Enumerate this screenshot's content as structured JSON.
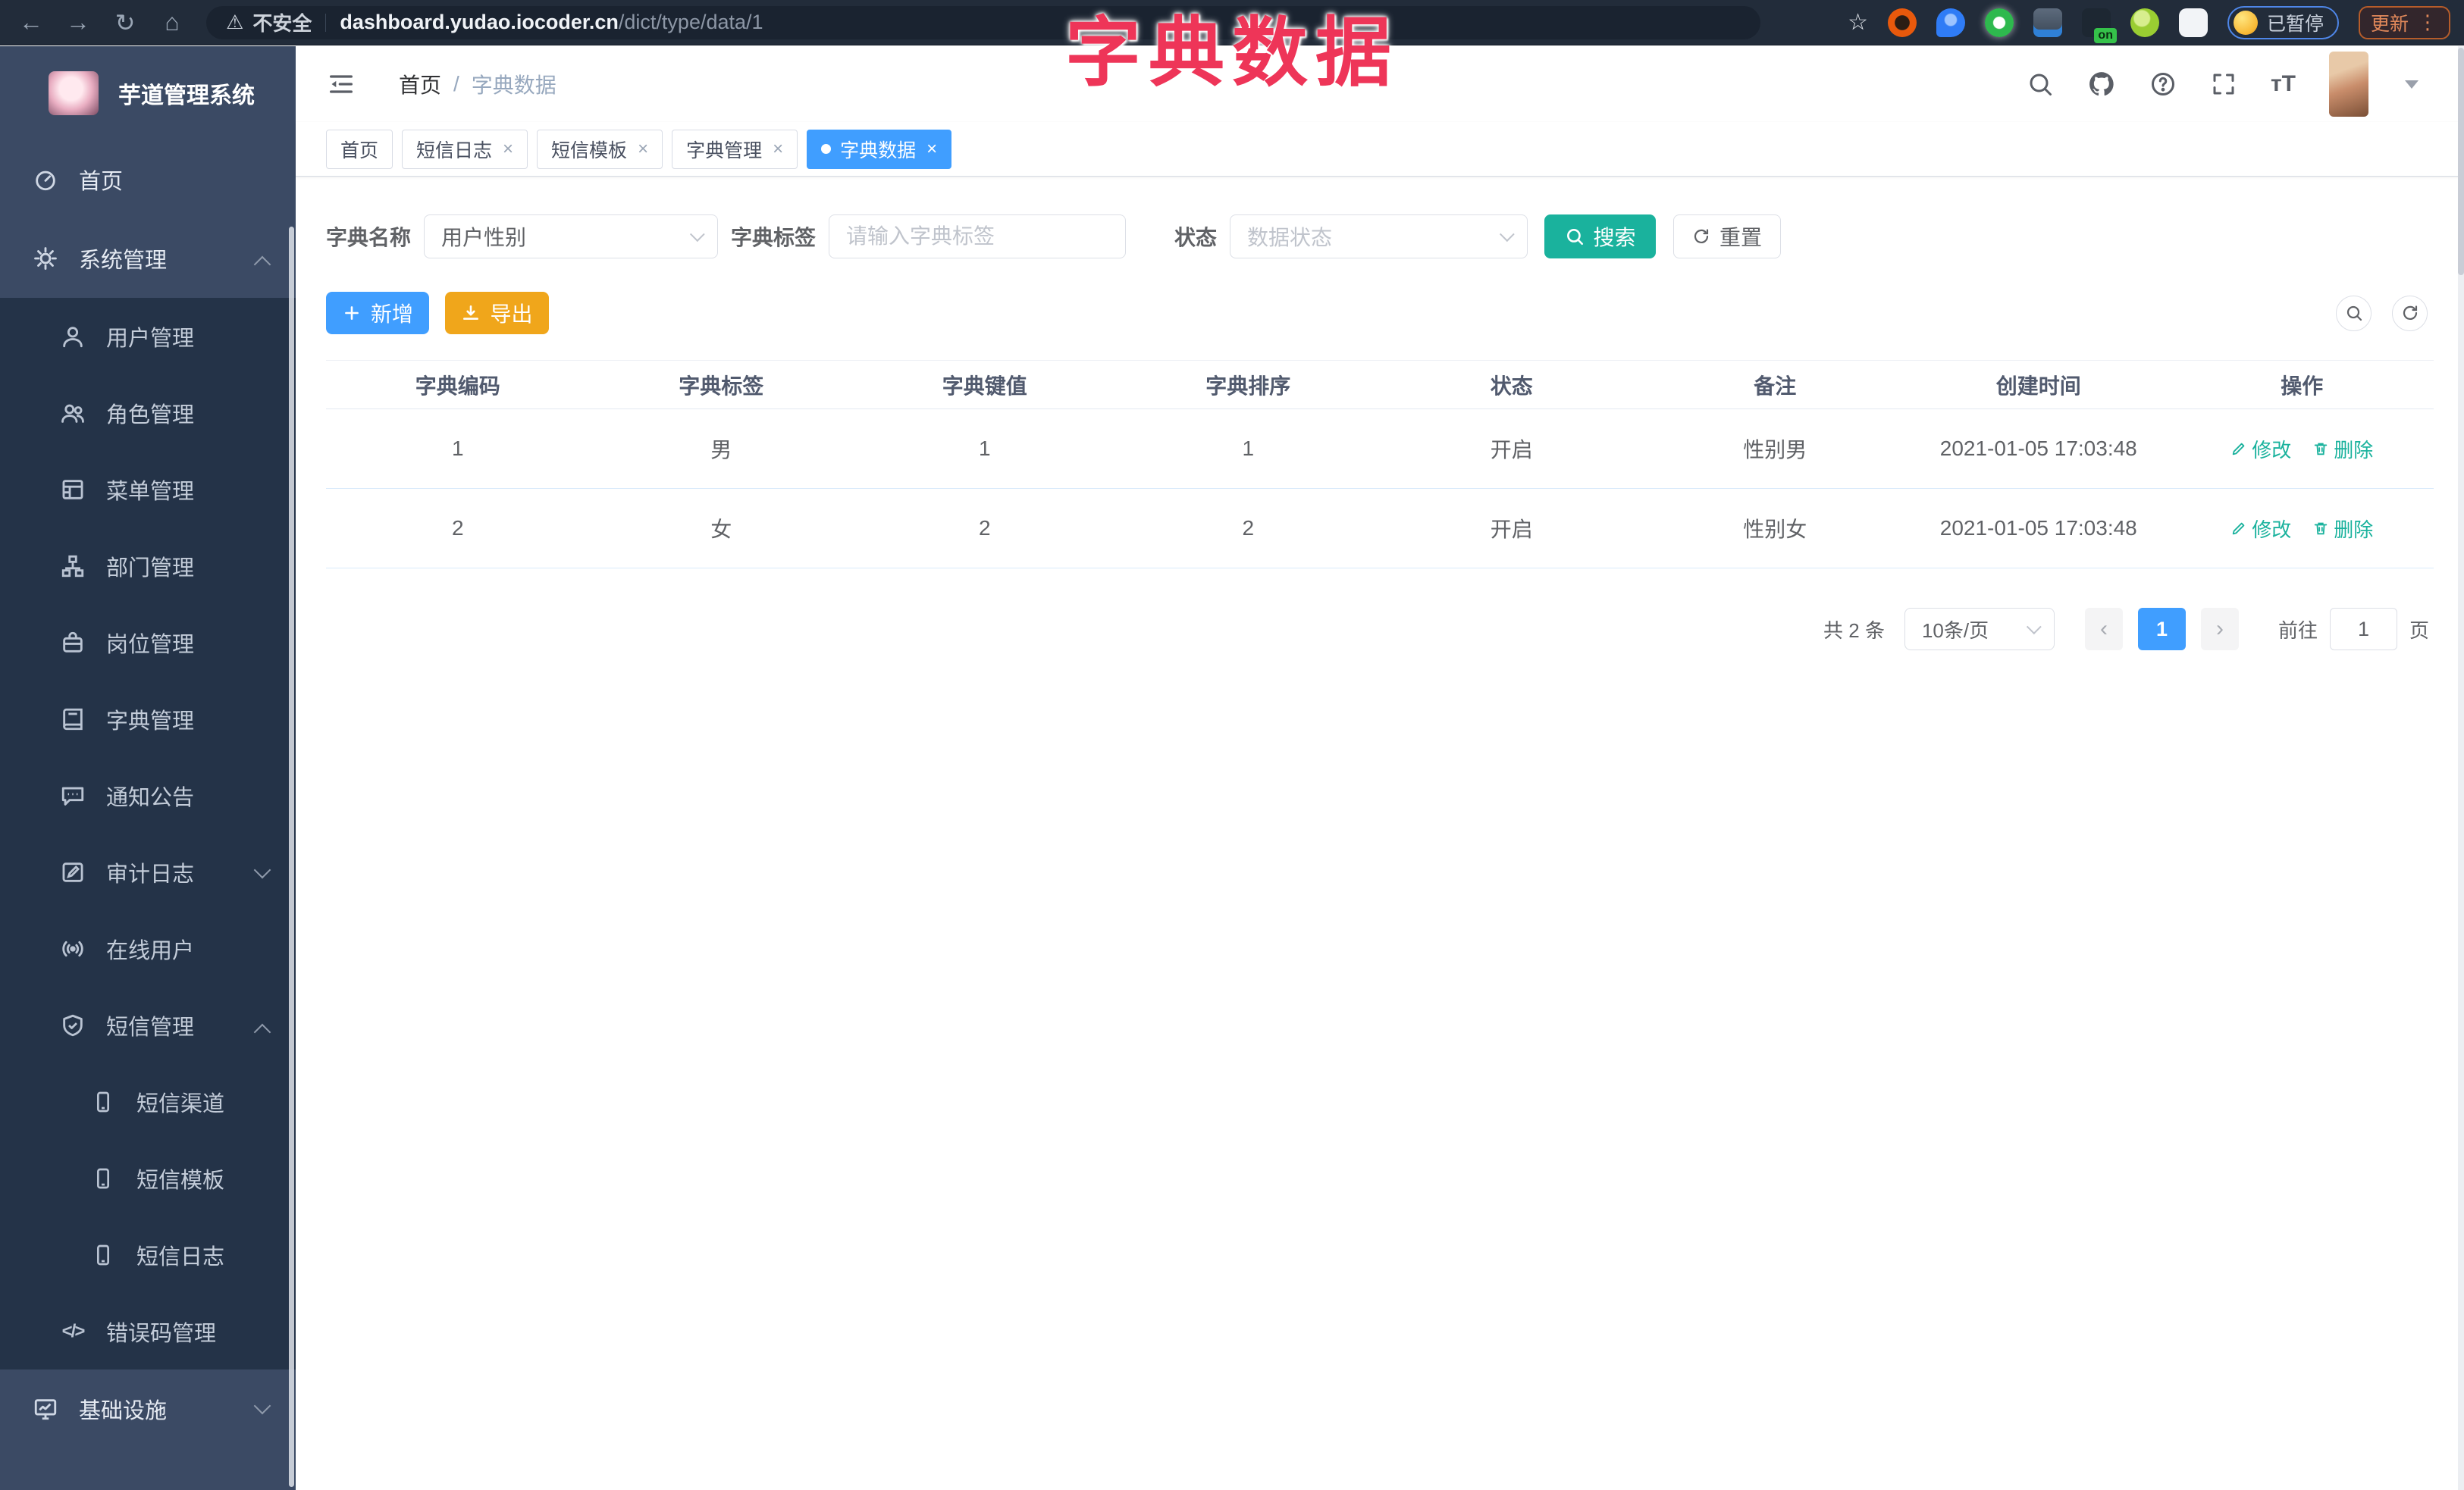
{
  "colors": {
    "primary": "#409eff",
    "teal_accent": "#1ab29d",
    "warning_orange": "#f0a61b",
    "annotation_pink": "#ee3558",
    "sidebar_bg": "#243348",
    "sidebar_root_bg": "#3b4a64",
    "chrome_bg": "#222c3a"
  },
  "browser": {
    "security_label": "不安全",
    "url_domain": "dashboard.yudao.iocoder.cn",
    "url_path": "/dict/type/data/1",
    "paused_badge": "已暂停",
    "update_button": "更新",
    "extension_badge": "on"
  },
  "annotation": {
    "title": "字典数据"
  },
  "sidebar": {
    "app_title": "芋道管理系统",
    "items": [
      {
        "label": "首页"
      },
      {
        "label": "系统管理"
      },
      {
        "label": "用户管理"
      },
      {
        "label": "角色管理"
      },
      {
        "label": "菜单管理"
      },
      {
        "label": "部门管理"
      },
      {
        "label": "岗位管理"
      },
      {
        "label": "字典管理"
      },
      {
        "label": "通知公告"
      },
      {
        "label": "审计日志"
      },
      {
        "label": "在线用户"
      },
      {
        "label": "短信管理"
      },
      {
        "label": "短信渠道"
      },
      {
        "label": "短信模板"
      },
      {
        "label": "短信日志"
      },
      {
        "label": "错误码管理"
      },
      {
        "label": "基础设施"
      }
    ]
  },
  "navbar": {
    "breadcrumb": {
      "root": "首页",
      "separator": "/",
      "current": "字典数据"
    }
  },
  "tabs": [
    {
      "label": "首页"
    },
    {
      "label": "短信日志"
    },
    {
      "label": "短信模板"
    },
    {
      "label": "字典管理"
    },
    {
      "label": "字典数据"
    }
  ],
  "filters": {
    "dict_name_label": "字典名称",
    "dict_name_value": "用户性别",
    "dict_label_label": "字典标签",
    "dict_label_placeholder": "请输入字典标签",
    "status_label": "状态",
    "status_placeholder": "数据状态",
    "search_button": "搜索",
    "reset_button": "重置"
  },
  "toolbar": {
    "add_button": "新增",
    "export_button": "导出"
  },
  "table": {
    "headers": [
      "字典编码",
      "字典标签",
      "字典键值",
      "字典排序",
      "状态",
      "备注",
      "创建时间",
      "操作"
    ],
    "rows": [
      {
        "code": "1",
        "label": "男",
        "value": "1",
        "sort": "1",
        "status": "开启",
        "remark": "性别男",
        "created": "2021-01-05 17:03:48"
      },
      {
        "code": "2",
        "label": "女",
        "value": "2",
        "sort": "2",
        "status": "开启",
        "remark": "性别女",
        "created": "2021-01-05 17:03:48"
      }
    ],
    "edit_action": "修改",
    "delete_action": "删除"
  },
  "pagination": {
    "total": "共 2 条",
    "page_size": "10条/页",
    "prev": "‹",
    "next": "›",
    "current_page": "1",
    "goto_label": "前往",
    "goto_value": "1",
    "goto_unit": "页"
  }
}
